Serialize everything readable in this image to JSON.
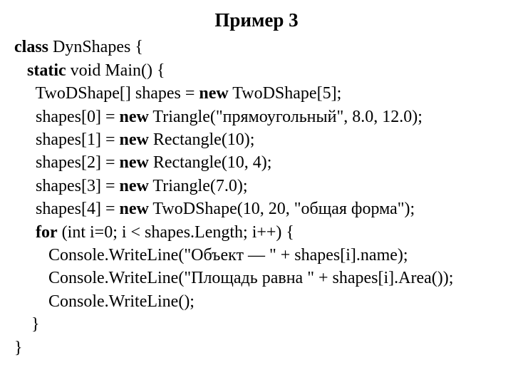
{
  "title": "Пример 3",
  "code": {
    "l1a": "class",
    "l1b": " DynShapes {",
    "l2a": "   ",
    "l2b": "static",
    "l2c": " void Main() {",
    "l3a": "     TwoDShape[] shapes = ",
    "l3b": "new",
    "l3c": " TwoDShape[5];",
    "l4a": "     shapes[0] = ",
    "l4b": "new",
    "l4c": " Triangle(\"прямоугольный\", 8.0, 12.0);",
    "l5a": "     shapes[1] = ",
    "l5b": "new",
    "l5c": " Rectangle(10);",
    "l6a": "     shapes[2] = ",
    "l6b": "new",
    "l6c": " Rectangle(10, 4);",
    "l7a": "     shapes[3] = ",
    "l7b": "new",
    "l7c": " Triangle(7.0);",
    "l8a": "     shapes[4] = ",
    "l8b": "new",
    "l8c": " TwoDShape(10, 20, \"общая форма\");",
    "l9a": "     ",
    "l9b": "for",
    "l9c": " (int i=0; i < shapes.Length; i++) {",
    "l10": "        Console.WriteLine(\"Объект — \" + shapes[i].name);",
    "l11": "        Console.WriteLine(\"Площадь равна \" + shapes[i].Area());",
    "l12": "        Console.WriteLine();",
    "l13": "    }",
    "l14": "}"
  }
}
